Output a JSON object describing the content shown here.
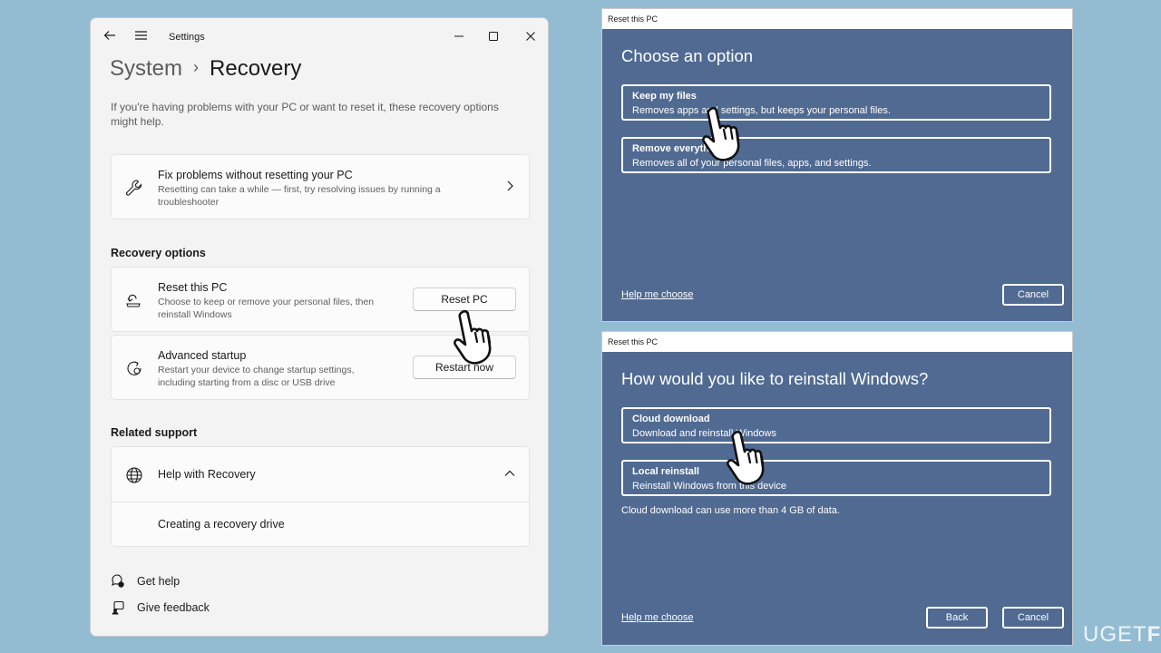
{
  "settings": {
    "window_title": "Settings",
    "breadcrumb_parent": "System",
    "breadcrumb_separator": "›",
    "page_title": "Recovery",
    "intro": "If you're having problems with your PC or want to reset it, these recovery options might help.",
    "fix_card": {
      "title": "Fix problems without resetting your PC",
      "subtitle": "Resetting can take a while — first, try resolving issues by running a troubleshooter"
    },
    "recovery_options_label": "Recovery options",
    "reset_card": {
      "title": "Reset this PC",
      "subtitle": "Choose to keep or remove your personal files, then reinstall Windows",
      "button": "Reset PC"
    },
    "advanced_card": {
      "title": "Advanced startup",
      "subtitle": "Restart your device to change startup settings, including starting from a disc or USB drive",
      "button": "Restart now"
    },
    "related_support_label": "Related support",
    "help_card": {
      "title": "Help with Recovery",
      "link": "Creating a recovery drive"
    },
    "footer": {
      "get_help": "Get help",
      "give_feedback": "Give feedback"
    }
  },
  "dialog1": {
    "window_title": "Reset this PC",
    "heading": "Choose an option",
    "options": [
      {
        "title": "Keep my files",
        "desc": "Removes apps and settings, but keeps your personal files."
      },
      {
        "title": "Remove everything",
        "desc": "Removes all of your personal files, apps, and settings."
      }
    ],
    "help_link": "Help me choose",
    "cancel": "Cancel"
  },
  "dialog2": {
    "window_title": "Reset this PC",
    "heading": "How would you like to reinstall Windows?",
    "options": [
      {
        "title": "Cloud download",
        "desc": "Download and reinstall Windows"
      },
      {
        "title": "Local reinstall",
        "desc": "Reinstall Windows from this device"
      }
    ],
    "note": "Cloud download can use more than 4 GB of data.",
    "help_link": "Help me choose",
    "back": "Back",
    "cancel": "Cancel"
  },
  "watermark": {
    "part1": "UG",
    "part2": "ET",
    "part3": "FIX"
  },
  "colors": {
    "background": "#93bcd3",
    "dialog_blue": "#506a92",
    "settings_bg": "#f3f3f3"
  }
}
